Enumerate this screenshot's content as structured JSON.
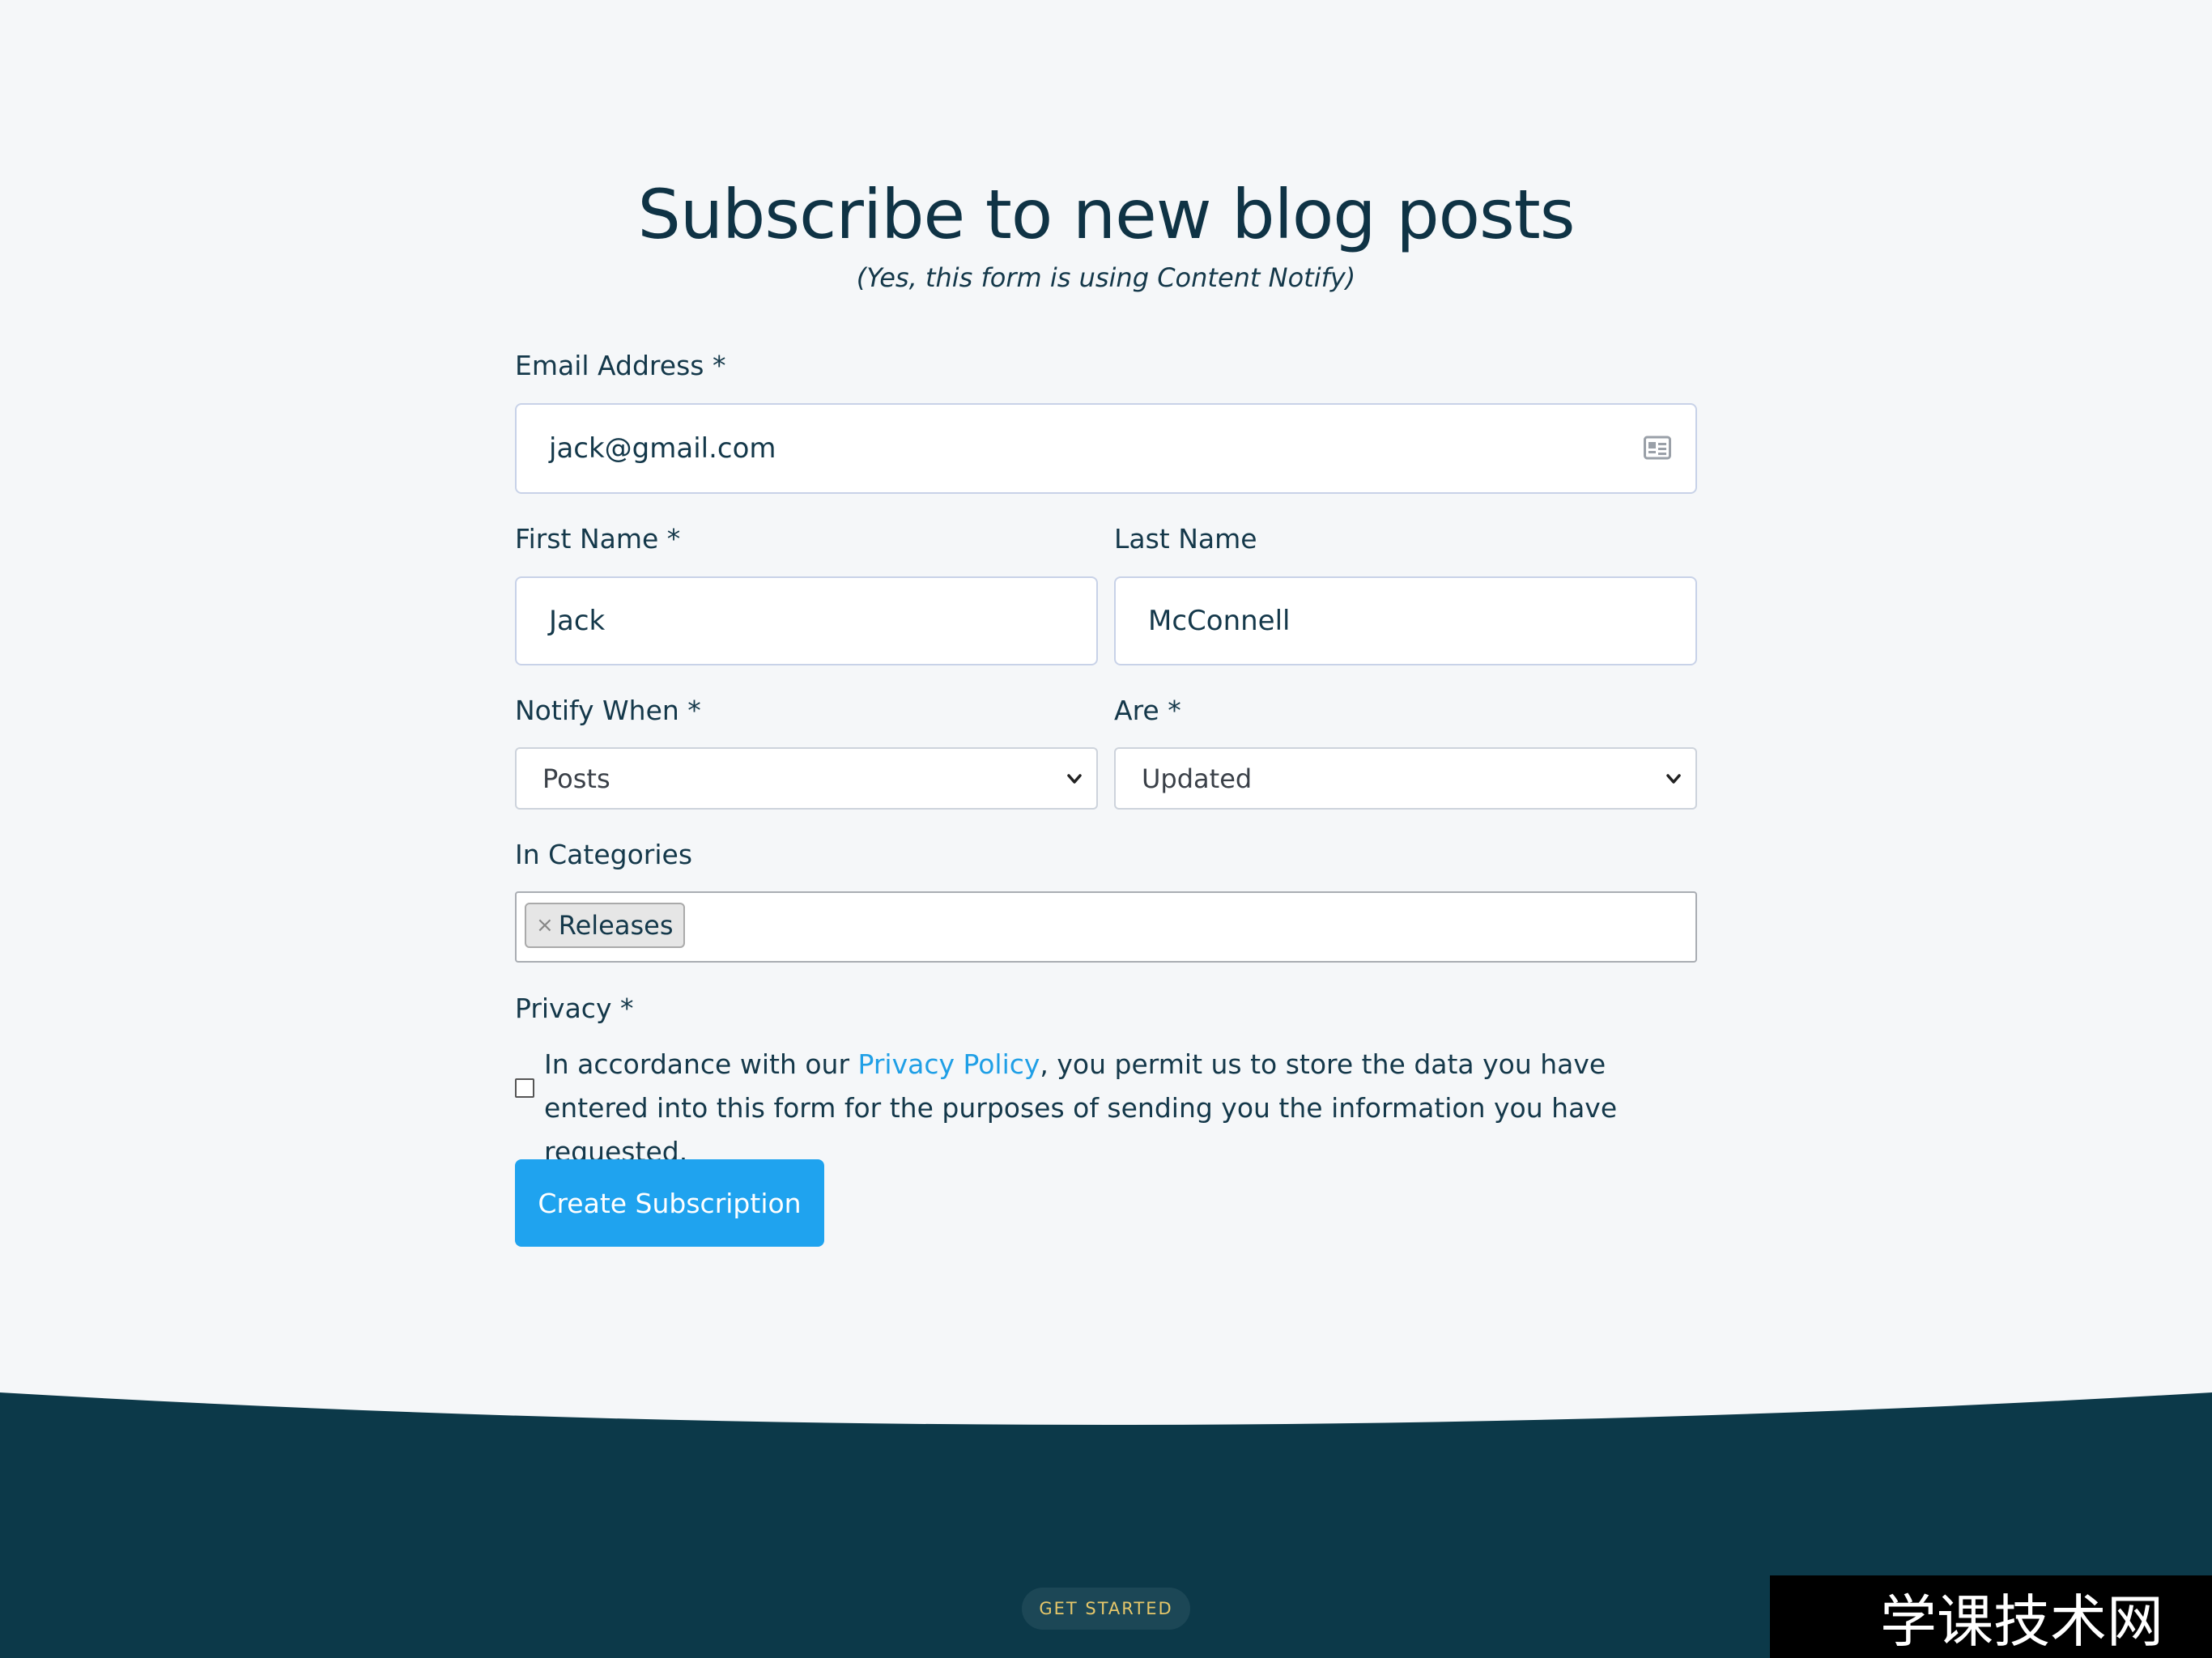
{
  "page": {
    "title": "Subscribe to new blog posts",
    "subtitle": "(Yes, this form is using Content Notify)"
  },
  "form": {
    "email": {
      "label": "Email Address *",
      "value": "jack@gmail.com",
      "icon": "contact-card-icon"
    },
    "first_name": {
      "label": "First Name *",
      "value": "Jack"
    },
    "last_name": {
      "label": "Last Name",
      "value": "McConnell"
    },
    "notify_when": {
      "label": "Notify When *",
      "selected": "Posts"
    },
    "are": {
      "label": "Are *",
      "selected": "Updated"
    },
    "categories": {
      "label": "In Categories",
      "tags": [
        "Releases"
      ],
      "remove_glyph": "×"
    },
    "privacy": {
      "label": "Privacy *",
      "checked": false,
      "text_before": "In accordance with our ",
      "link_text": "Privacy Policy",
      "text_after": ", you permit us to store the data you have entered into this form for the purposes of sending you the information you have requested."
    },
    "submit_label": "Create Subscription"
  },
  "footer": {
    "badge": "GET STARTED",
    "background_color": "#0c3949"
  },
  "watermark": {
    "text": "学课技术网"
  },
  "colors": {
    "accent": "#1fa3ef",
    "link": "#1f9fe6",
    "text": "#14384a",
    "background": "#f5f7f9"
  }
}
